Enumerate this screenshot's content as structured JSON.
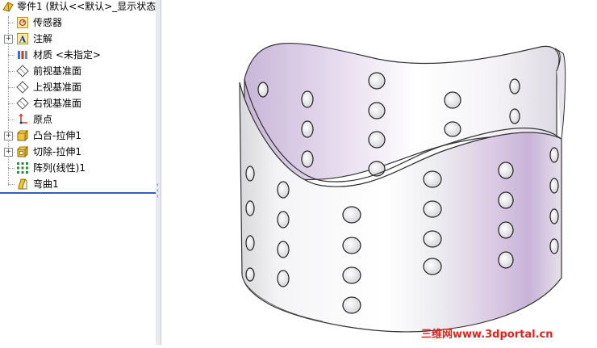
{
  "tree": {
    "root_label": "零件1 (默认<<默认>_显示状态",
    "items": [
      {
        "label": "传感器",
        "icon": "sensor-icon",
        "expandable": false
      },
      {
        "label": "注解",
        "icon": "annotation-icon",
        "expandable": true
      },
      {
        "label": "材质 <未指定>",
        "icon": "material-icon",
        "expandable": false
      },
      {
        "label": "前视基准面",
        "icon": "plane-icon",
        "expandable": false
      },
      {
        "label": "上视基准面",
        "icon": "plane-icon",
        "expandable": false
      },
      {
        "label": "右视基准面",
        "icon": "plane-icon",
        "expandable": false
      },
      {
        "label": "原点",
        "icon": "origin-icon",
        "expandable": false
      },
      {
        "label": "凸台-拉伸1",
        "icon": "extrude-boss-icon",
        "expandable": true
      },
      {
        "label": "切除-拉伸1",
        "icon": "extrude-cut-icon",
        "expandable": true
      },
      {
        "label": "阵列(线性)1",
        "icon": "linear-pattern-icon",
        "expandable": false
      },
      {
        "label": "弯曲1",
        "icon": "flex-icon",
        "expandable": false
      }
    ]
  },
  "watermark": "三维网www.3dportal.cn",
  "colors": {
    "accent": "#2f5fbf",
    "part_shade": "#c9b7d8",
    "watermark": "#e0221d"
  }
}
